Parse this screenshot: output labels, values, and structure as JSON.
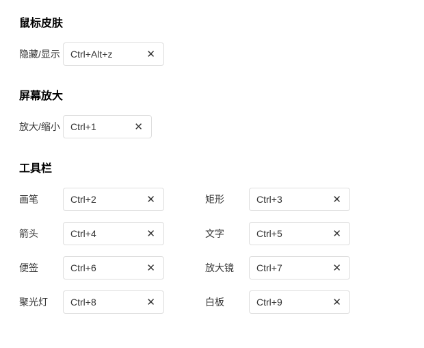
{
  "sections": {
    "mouseSkin": {
      "title": "鼠标皮肤",
      "items": {
        "hideShow": {
          "label": "隐藏/显示",
          "key": "Ctrl+Alt+z"
        }
      }
    },
    "screenZoom": {
      "title": "屏幕放大",
      "items": {
        "zoom": {
          "label": "放大/缩小",
          "key": "Ctrl+1"
        }
      }
    },
    "toolbar": {
      "title": "工具栏",
      "items": {
        "brush": {
          "label": "画笔",
          "key": "Ctrl+2"
        },
        "rect": {
          "label": "矩形",
          "key": "Ctrl+3"
        },
        "arrow": {
          "label": "箭头",
          "key": "Ctrl+4"
        },
        "text": {
          "label": "文字",
          "key": "Ctrl+5"
        },
        "note": {
          "label": "便签",
          "key": "Ctrl+6"
        },
        "magnifier": {
          "label": "放大镜",
          "key": "Ctrl+7"
        },
        "spotlight": {
          "label": "聚光灯",
          "key": "Ctrl+8"
        },
        "whiteboard": {
          "label": "白板",
          "key": "Ctrl+9"
        }
      }
    }
  },
  "clearGlyph": "✕"
}
